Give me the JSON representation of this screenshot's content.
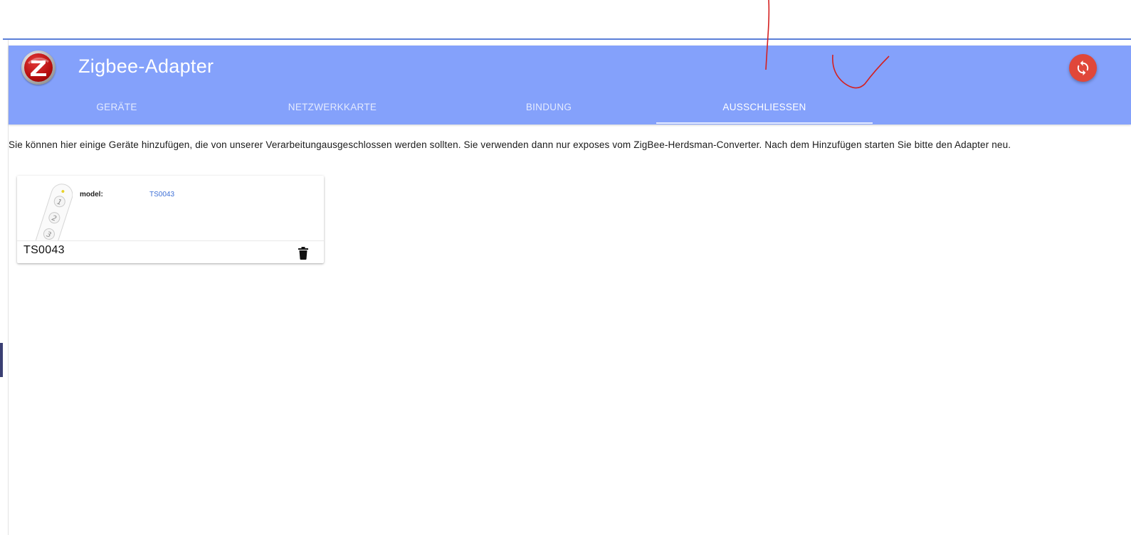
{
  "header": {
    "title": "Zigbee-Adapter",
    "logo_icon": "zigbee-logo-icon",
    "background_color": "#84a1fb",
    "refresh_icon": "refresh-icon",
    "refresh_color": "#e0473a"
  },
  "tabs": [
    {
      "label": "GERÄTE",
      "active": false
    },
    {
      "label": "NETZWERKKARTE",
      "active": false
    },
    {
      "label": "BINDUNG",
      "active": false
    },
    {
      "label": "AUSSCHLIESSEN",
      "active": true
    }
  ],
  "main": {
    "description": "Sie können hier einige Geräte hinzufügen, die von unserer Verarbeitungausgeschlossen werden sollten. Sie verwenden dann nur exposes vom ZigBee-Herdsman-Converter. Nach dem Hinzufügen starten Sie bitte den Adapter neu.",
    "devices": [
      {
        "name": "TS0043",
        "info_label": "model:",
        "info_value": "TS0043",
        "image_icon": "remote-control-icon",
        "delete_icon": "trash-icon"
      }
    ]
  },
  "annotation": {
    "color": "#d42020"
  }
}
